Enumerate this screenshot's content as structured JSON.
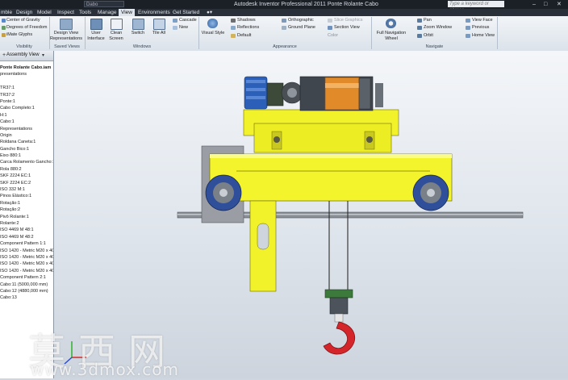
{
  "titlebar": {
    "quick_access": "Dabo",
    "title": "Autodesk Inventor Professional 2011    Ponte Rolante Cabo",
    "search_placeholder": "Type a keyword or phrase",
    "min": "–",
    "max": "□",
    "close": "✕"
  },
  "tabs": [
    {
      "label": "mble"
    },
    {
      "label": "Design"
    },
    {
      "label": "Model"
    },
    {
      "label": "Inspect"
    },
    {
      "label": "Tools"
    },
    {
      "label": "Manage"
    },
    {
      "label": "View"
    },
    {
      "label": "Environments"
    },
    {
      "label": "Get Started"
    }
  ],
  "ribbon": {
    "visibility": {
      "center_gravity": "Center of Gravity",
      "degrees_freedom": "Degrees of Freedom",
      "ilimate": "iMate Glyphs",
      "group": "Visibility"
    },
    "saved_views": {
      "design_view_1": "Design View",
      "design_view_2": "Representations",
      "group": "Saved Views"
    },
    "windows": {
      "user_interface_1": "User",
      "user_interface_2": "Interface",
      "clean_screen_1": "Clean",
      "clean_screen_2": "Screen",
      "switch": "Switch",
      "tile_all": "Tile All",
      "cascade": "Cascade",
      "new": "New",
      "group": "Windows"
    },
    "appearance": {
      "visual_style": "Visual Style",
      "shadows": "Shadows",
      "reflections": "Reflections",
      "default": "Default",
      "orthographic": "Orthographic",
      "ground_plane": "Ground Plane",
      "slice_graphics": "Slice Graphics",
      "section_view": "Section View",
      "color": "Color",
      "group": "Appearance"
    },
    "navigate": {
      "full_nav_1": "Full Navigation",
      "full_nav_2": "Wheel",
      "pan": "Pan",
      "zoom_window": "Zoom Window",
      "orbit": "Orbit",
      "view_face": "View Face",
      "previous": "Previous",
      "home_view": "Home View",
      "group": "Navigate"
    }
  },
  "browser": {
    "header": "Assembly View",
    "items": [
      "Ponte Rolante Cabo.iam",
      "presentations",
      "",
      "TR37:1",
      "TR37:2",
      "Ponte:1",
      "Cabo Completo:1",
      "H:1",
      "Cabo:1",
      "Representations",
      "Origin",
      "Roldana Caneta:1",
      "Gancho Bico:1",
      "Eixo 880:1",
      "Carca Rolamento Gancho:1",
      "Rola 880:2",
      "SKF 2224 EC:1",
      "SKF 2224 EC:2",
      "ISO 332 M:1",
      "Pinos Elástico:1",
      "Rotação:1",
      "Rotação:2",
      "Pivô Rolante:1",
      "Rolante:2",
      "ISO 4469 M 48:1",
      "ISO 4469 M 48:2",
      "Component Pattern 1:1",
      "ISO 1420 - Metric M20 x 40:1",
      "ISO 1420 - Metric M20 x 40:2",
      "ISO 1420 - Metric M20 x 40:3",
      "ISO 1420 - Metric M20 x 40:4",
      "Component Pattern 2:1",
      "Cabo:11 (5000,000 mm)",
      "Cabo:12 (4880,000 mm)",
      "Cabo:13"
    ]
  },
  "watermark": {
    "chars": "莫西网",
    "url": "www.3dmox.com"
  },
  "colors": {
    "accent": "#2d5fa8",
    "yellow": "#f2f22a",
    "blue_motor": "#2c5fb8",
    "orange_drum": "#e08a2a",
    "hook_red": "#d3252a"
  }
}
